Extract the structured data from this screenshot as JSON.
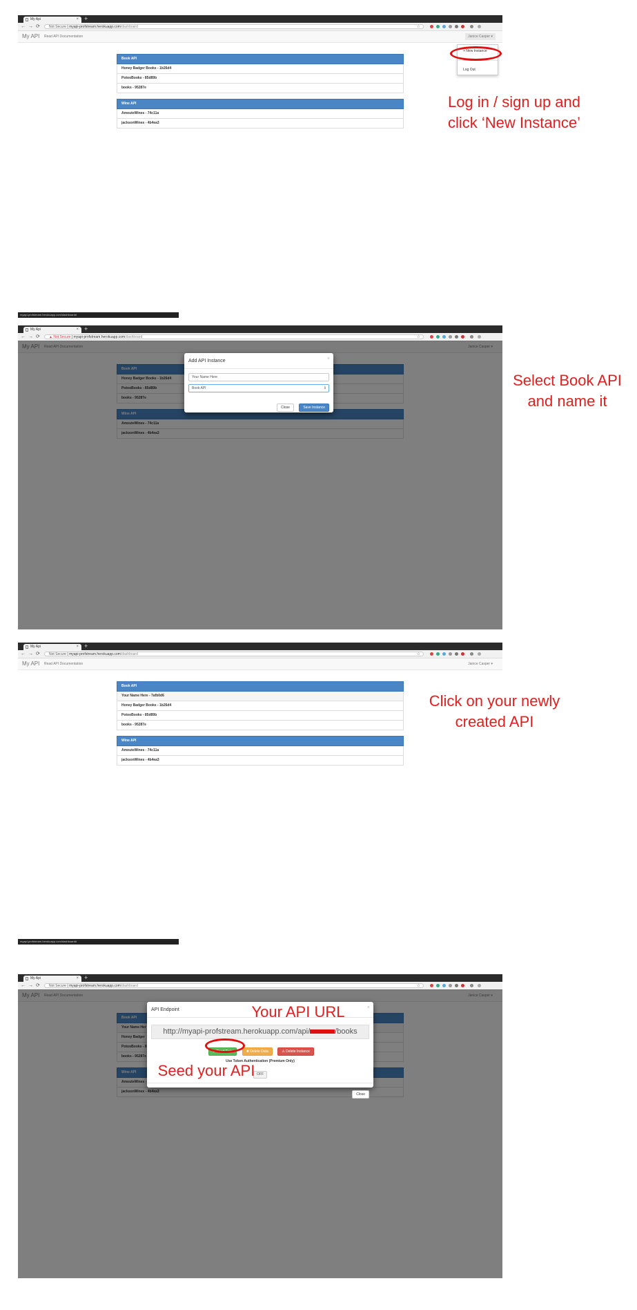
{
  "browser": {
    "tab_title": "My Api",
    "new_tab": "+",
    "not_secure": "Not Secure",
    "url_host": "myapi-profstream.herokuapp.com",
    "url_path": "/dashboard",
    "status_url": "myapi-profstream.herokuapp.com/dashboard#"
  },
  "app": {
    "brand": "My API",
    "nav_link": "Read API Documentation",
    "user": "Janice Casper ▾"
  },
  "dropdown": {
    "new_instance": "+ New Instance",
    "log_out": "Log Out"
  },
  "lists": {
    "book_header": "Book API",
    "wine_header": "Wine API",
    "book_items_initial": [
      "Honey Badger Books - 1b26d4",
      "PotooBooks - 85d89b",
      "books - 95287e"
    ],
    "book_items_updated": [
      "Your Name Here - 7afb0d6",
      "Honey Badger Books - 1b26d4",
      "PotooBooks - 85d89b",
      "books - 95287e"
    ],
    "wine_items": [
      "AmouteWines - 74c11a",
      "jacksonWines - 4b4ea3"
    ]
  },
  "add_modal": {
    "title": "Add API Instance",
    "name_placeholder": "Your Name Here",
    "select_value": "Book API",
    "close_btn": "Close",
    "save_btn": "Save Instance"
  },
  "endpoint_modal": {
    "title": "API Endpoint",
    "url_prefix": "http://myapi-profstream.herokuapp.com/api/",
    "url_suffix": "/books",
    "seed_btn": "⟳ Seed Data",
    "delete_data_btn": "✖ Delete Data",
    "delete_instance_btn": "⚠ Delete Instance",
    "token_label": "Use Token Authentication (Premium Only)",
    "toggle": "OFF",
    "close_btn": "Close",
    "truncated_rows": [
      "Your Name Her",
      "Honey Badger",
      "PotooBooks - 8",
      "books - 95287e"
    ]
  },
  "annotations": {
    "step1": "Log in / sign up and\nclick ‘New Instance’",
    "step2": "Select Book API\nand name it",
    "step3": "Click on your newly\ncreated API",
    "api_url": "Your API URL",
    "seed": "Seed your API"
  },
  "colors": {
    "annotation": "#e02020",
    "primary": "#4a86c5"
  }
}
